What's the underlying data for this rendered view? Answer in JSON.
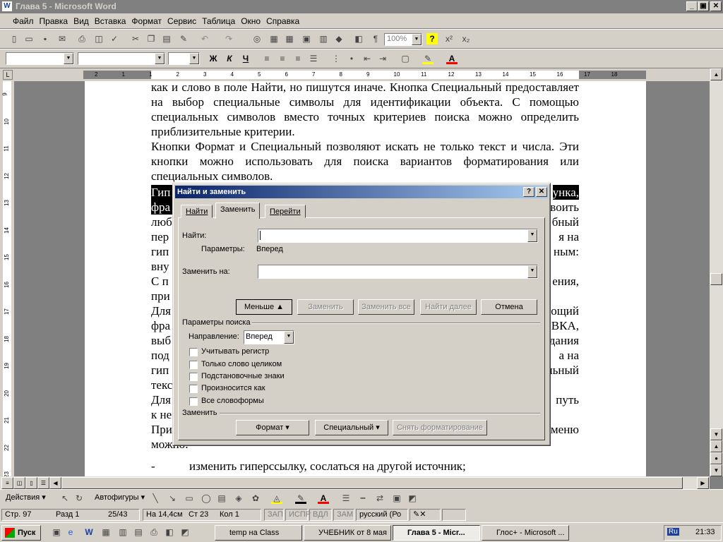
{
  "window": {
    "title": "Глава 5 - Microsoft Word",
    "min": "_",
    "max": "▣",
    "close": "✕"
  },
  "menu": [
    "Файл",
    "Правка",
    "Вид",
    "Вставка",
    "Формат",
    "Сервис",
    "Таблица",
    "Окно",
    "Справка"
  ],
  "toolbar": {
    "zoom": "100%",
    "style": "",
    "font": "",
    "size": "",
    "bold": "Ж",
    "italic": "К",
    "underline": "Ч"
  },
  "ruler": {
    "marks": [
      "2",
      "1",
      "1",
      "2",
      "3",
      "4",
      "5",
      "6",
      "7",
      "8",
      "9",
      "10",
      "11",
      "12",
      "13",
      "14",
      "15",
      "16",
      "17",
      "18"
    ],
    "vmarks": [
      "9",
      "10",
      "11",
      "12",
      "13",
      "14",
      "15",
      "16",
      "17",
      "18",
      "19",
      "20",
      "21",
      "22",
      "23"
    ]
  },
  "document": {
    "paragraphs": [
      "как и слово в поле Найти, но пишутся иначе. Кнопка Специальный предоставляет на выбор специальные символы для идентификации объекта.  С помощью специальных символов вместо точных критериев поиска можно определить приблизительные критерии.",
      "Кнопки Формат и Специальный позволяют искать не только текст и числа. Эти кнопки можно использовать для поиска вариантов форматирования или специальных символов."
    ],
    "left_fragments": [
      "Гип",
      "фра",
      "люб",
      "пер",
      "гип",
      "вну",
      "С п",
      "при",
      "Для",
      "фра",
      "выб",
      "под",
      "гип",
      "текс",
      "Для",
      "к не",
      "При",
      "можно:"
    ],
    "right_fragments": [
      "унка,",
      "воить",
      "бный",
      "я на",
      "ным:",
      "ения,",
      "ощий",
      "ВКА,",
      "дания",
      "а на",
      "льный",
      "путь",
      "меню"
    ],
    "list_dash": "-",
    "list_item": "изменить гиперссылку, сослаться на другой источник;"
  },
  "dialog": {
    "title": "Найти и заменить",
    "help": "?",
    "close": "✕",
    "tabs": [
      "Найти",
      "Заменить",
      "Перейти"
    ],
    "find_label": "Найти:",
    "find_value": "",
    "params_label": "Параметры:",
    "params_value": "Вперед",
    "replace_label": "Заменить на:",
    "replace_value": "",
    "buttons": {
      "less": "Меньше ▲",
      "replace": "Заменить",
      "replace_all": "Заменить все",
      "find_next": "Найти далее",
      "cancel": "Отмена"
    },
    "search_section": "Параметры поиска",
    "direction_label": "Направление:",
    "direction_value": "Вперед",
    "options": [
      "Учитывать регистр",
      "Только слово целиком",
      "Подстановочные знаки",
      "Произносится как",
      "Все словоформы"
    ],
    "replace_section": "Заменить",
    "bottom_buttons": {
      "format": "Формат ▾",
      "special": "Специальный ▾",
      "no_format": "Снять форматирование"
    }
  },
  "drawbar": {
    "actions": "Действия ▾",
    "autoshapes": "Автофигуры ▾"
  },
  "status": {
    "page": "Стр. 97",
    "section": "Разд 1",
    "pages": "25/43",
    "at": "На 14,4см",
    "line": "Ст 23",
    "col": "Кол 1",
    "rec": "ЗАП",
    "trk": "ИСПР",
    "ext": "ВДЛ",
    "ovr": "ЗАМ",
    "lang": "русский (Ро"
  },
  "taskbar": {
    "start": "Пуск",
    "tasks": [
      "temp на Class",
      "УЧЕБНИК от 8 мая",
      "Глава 5 - Micr...",
      "Глос+ - Microsoft ..."
    ],
    "lang": "Ru",
    "time": "21:33"
  }
}
